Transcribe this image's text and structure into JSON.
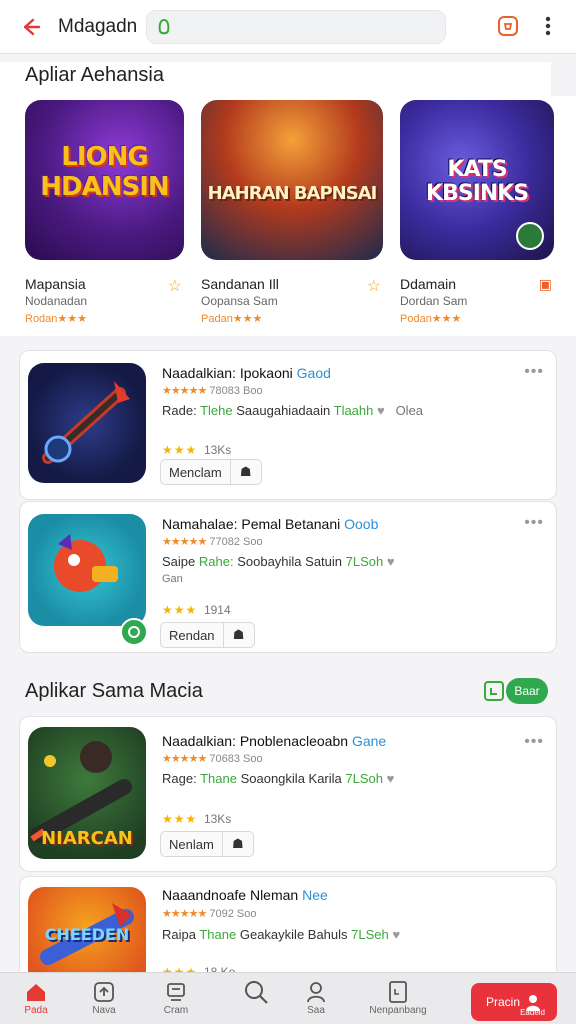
{
  "header": {
    "title": "Mdagadn",
    "search_placeholder": ""
  },
  "featured": {
    "title": "Apliar Aehansia",
    "items": [
      {
        "art_text": "LIONG HDANSIN",
        "name": "Mapansia",
        "sub": "Nodanadan",
        "rating": "Rodan★★★"
      },
      {
        "art_text": "HAHRAN BAPNSAI",
        "name": "Sandanan Ill",
        "sub": "Oopansa Sam",
        "rating": "Padan★★★"
      },
      {
        "art_text": "KATS KBSINKS",
        "name": "Ddamain",
        "sub": "Dordan Sam",
        "rating": "Podan★★★"
      }
    ]
  },
  "list1": [
    {
      "name": "Naadalkian: Ipokaoni",
      "tag": "Gaod",
      "meta_stars": "★★★★★",
      "meta_text": "78083 Boo",
      "desc_a": "Rade:",
      "desc_b": "Tlehe",
      "desc_c": "Saaugahiadaain",
      "desc_d": "Tlaahh",
      "desc_e": "Olea",
      "extra": "",
      "rating_stars": "★★★",
      "rating_text": "13Ks",
      "button": "Menclam"
    },
    {
      "name": "Namahalae: Pemal Betanani",
      "tag": "Ooob",
      "meta_stars": "★★★★★",
      "meta_text": "77082 Soo",
      "desc_a": "Saipe",
      "desc_b": "Rahe:",
      "desc_c": "Soobayhila Satuin",
      "desc_d": "7LSoh",
      "desc_e": "",
      "extra": "Gan",
      "rating_stars": "★★★",
      "rating_text": "1914",
      "button": "Rendan"
    }
  ],
  "section2": {
    "title": "Aplikar Sama Macia",
    "see_all": "Baar"
  },
  "list2": [
    {
      "name": "Naadalkian: Pnoblenacleoabn",
      "tag": "Gane",
      "meta_stars": "★★★★★",
      "meta_text": "70683 Soo",
      "desc_a": "Rage:",
      "desc_b": "Thane",
      "desc_c": "Soaongkila Karila",
      "desc_d": "7LSoh",
      "desc_e": "",
      "extra": "",
      "rating_stars": "★★★",
      "rating_text": "13Ks",
      "button": "Nenlam",
      "art_text": "NIARCAN"
    },
    {
      "name": "Naaandnoafe Nleman",
      "tag": "Nee",
      "meta_stars": "★★★★★",
      "meta_text": "7092 Soo",
      "desc_a": "Raipa",
      "desc_b": "Thane",
      "desc_c": "Geakaykile Bahuls",
      "desc_d": "7LSeh",
      "desc_e": "",
      "extra": "",
      "rating_stars": "★★★",
      "rating_text": "18 Ko",
      "button": "",
      "art_text": "CHEEDEN"
    }
  ],
  "nav": [
    {
      "label": "Pada",
      "icon": "home-icon"
    },
    {
      "label": "Nava",
      "icon": "upload-icon"
    },
    {
      "label": "Cram",
      "icon": "tray-icon"
    },
    {
      "label": "",
      "icon": "search-icon"
    },
    {
      "label": "Saa",
      "icon": "person-icon"
    },
    {
      "label": "Nenpanbang",
      "icon": "tablet-icon"
    }
  ],
  "nav_cta": {
    "label": "Pracin",
    "sublabel": "Eadeid"
  }
}
